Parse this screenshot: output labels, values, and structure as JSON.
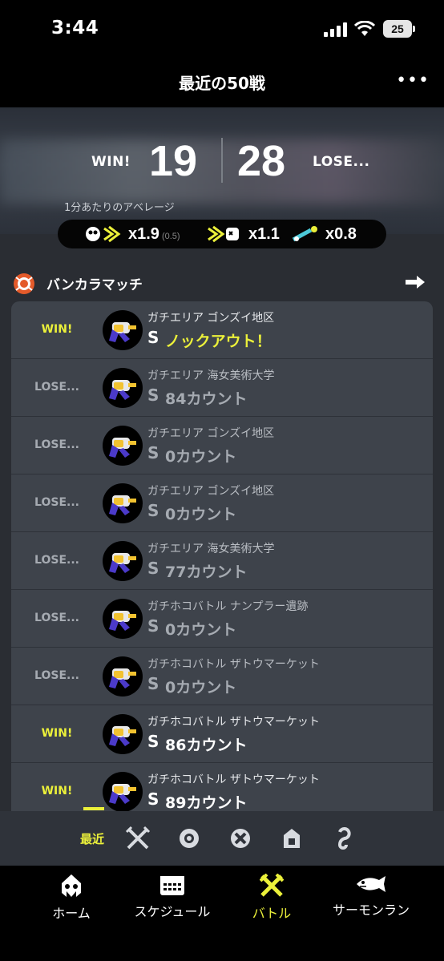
{
  "status_bar": {
    "time": "3:44",
    "battery": "25"
  },
  "header": {
    "title": "最近の50戦",
    "more": "•••"
  },
  "summary": {
    "win_label": "WIN!",
    "win_count": "19",
    "lose_count": "28",
    "lose_label": "LOSE...",
    "average_label": "1分あたりのアベレージ",
    "kills": "x1.9",
    "assists": "(0.5)",
    "deaths": "x1.1",
    "specials": "x0.8"
  },
  "section": {
    "title": "バンカラマッチ"
  },
  "battles": [
    {
      "result": "WIN!",
      "outcome": "win",
      "mode": "ガチエリア ゴンズイ地区",
      "rank": "S",
      "score": "ノックアウト！",
      "knockout": true
    },
    {
      "result": "LOSE...",
      "outcome": "lose",
      "mode": "ガチエリア 海女美術大学",
      "rank": "S",
      "score": "84カウント",
      "knockout": false
    },
    {
      "result": "LOSE...",
      "outcome": "lose",
      "mode": "ガチエリア ゴンズイ地区",
      "rank": "S",
      "score": "0カウント",
      "knockout": false
    },
    {
      "result": "LOSE...",
      "outcome": "lose",
      "mode": "ガチエリア ゴンズイ地区",
      "rank": "S",
      "score": "0カウント",
      "knockout": false
    },
    {
      "result": "LOSE...",
      "outcome": "lose",
      "mode": "ガチエリア 海女美術大学",
      "rank": "S",
      "score": "77カウント",
      "knockout": false
    },
    {
      "result": "LOSE...",
      "outcome": "lose",
      "mode": "ガチホコバトル ナンプラー遺跡",
      "rank": "S",
      "score": "0カウント",
      "knockout": false
    },
    {
      "result": "LOSE...",
      "outcome": "lose",
      "mode": "ガチホコバトル ザトウマーケット",
      "rank": "S",
      "score": "0カウント",
      "knockout": false
    },
    {
      "result": "WIN!",
      "outcome": "win",
      "mode": "ガチホコバトル ザトウマーケット",
      "rank": "S",
      "score": "86カウント",
      "knockout": false
    },
    {
      "result": "WIN!",
      "outcome": "win",
      "mode": "ガチホコバトル ザトウマーケット",
      "rank": "S",
      "score": "89カウント",
      "knockout": false
    }
  ],
  "filter": {
    "selected": "最近",
    "icons": [
      "regular-battle-icon",
      "anarchy-battle-icon",
      "x-battle-icon",
      "private-battle-icon",
      "other-battle-icon"
    ]
  },
  "tabs": [
    {
      "label": "ホーム",
      "icon": "squid-icon"
    },
    {
      "label": "スケジュール",
      "icon": "calendar-icon"
    },
    {
      "label": "バトル",
      "icon": "battle-icon",
      "active": true
    },
    {
      "label": "サーモンラン",
      "icon": "salmon-icon"
    }
  ],
  "colors": {
    "accent": "#ebf03a",
    "panel": "#3e434b",
    "background": "#2a2d33"
  }
}
